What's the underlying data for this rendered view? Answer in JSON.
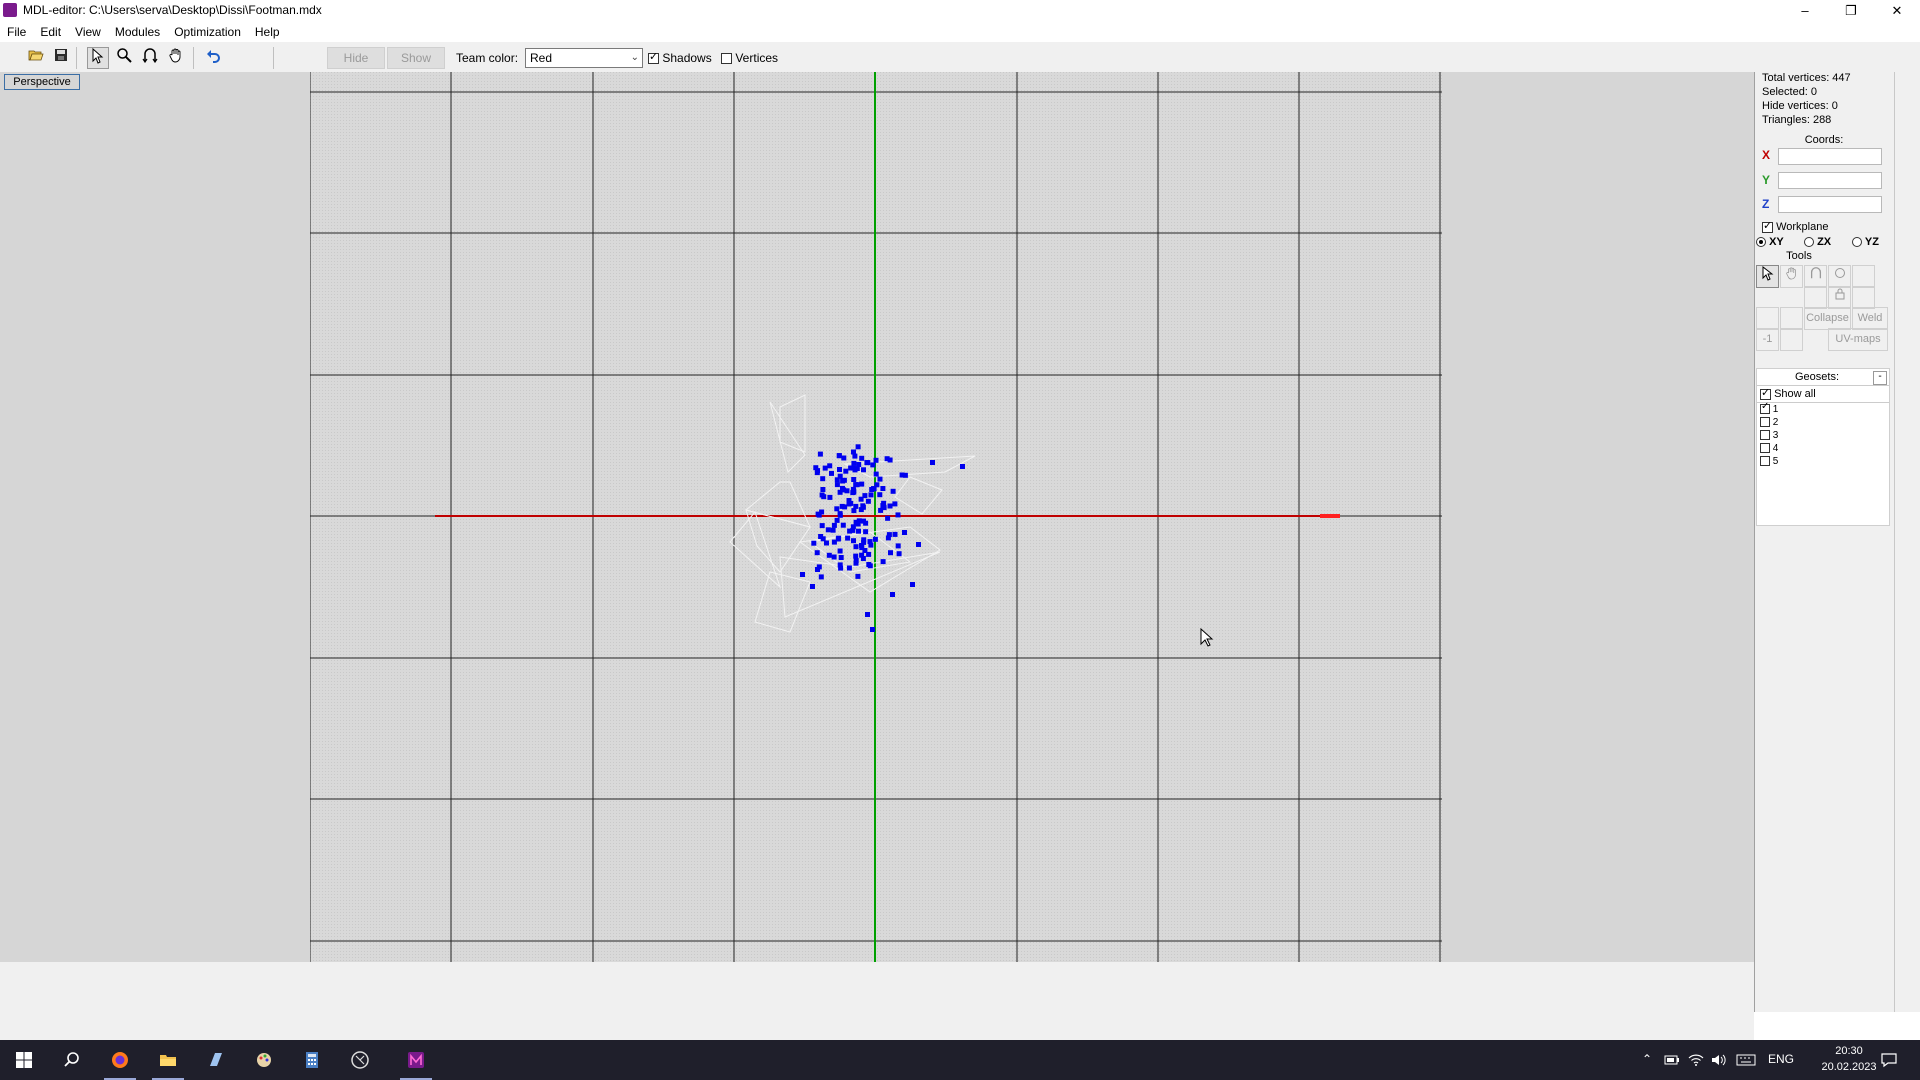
{
  "window": {
    "title": "MDL-editor: C:\\Users\\serva\\Desktop\\Dissi\\Footman.mdx",
    "minimize": "–",
    "maximize": "❐",
    "close": "✕"
  },
  "menu": [
    "File",
    "Edit",
    "View",
    "Modules",
    "Optimization",
    "Help"
  ],
  "toolbar": {
    "hide_label": "Hide",
    "show_label": "Show",
    "team_color_label": "Team color:",
    "team_color_value": "Red",
    "shadows_label": "Shadows",
    "shadows_checked": true,
    "vertices_label": "Vertices",
    "vertices_checked": false
  },
  "viewport": {
    "view_label": "Perspective",
    "axis_colors": {
      "x": "#c00000",
      "y": "#00a000"
    },
    "vertex_color": "#0000ee",
    "wire_color": "#f2f2f2"
  },
  "stats": {
    "total_vertices": "Total vertices: 447",
    "selected": "Selected: 0",
    "hide_vertices": "Hide vertices: 0",
    "triangles": "Triangles: 288"
  },
  "coords": {
    "title": "Coords:",
    "x_label": "X",
    "y_label": "Y",
    "z_label": "Z",
    "x_value": "",
    "y_value": "",
    "z_value": ""
  },
  "workplane": {
    "label": "Workplane",
    "checked": true,
    "planes": [
      {
        "label": "XY",
        "selected": true
      },
      {
        "label": "ZX",
        "selected": false
      },
      {
        "label": "YZ",
        "selected": false
      }
    ]
  },
  "tools": {
    "title": "Tools",
    "collapse_label": "Collapse",
    "weld_label": "Weld",
    "minus_one_label": "-1",
    "uv_maps_label": "UV-maps"
  },
  "geosets": {
    "title": "Geosets:",
    "collapse": "-",
    "show_all_label": "Show all",
    "show_all_checked": true,
    "items": [
      {
        "label": "1",
        "checked": true
      },
      {
        "label": "2",
        "checked": false
      },
      {
        "label": "3",
        "checked": false
      },
      {
        "label": "4",
        "checked": false
      },
      {
        "label": "5",
        "checked": false
      }
    ]
  },
  "taskbar": {
    "apps": [
      "start-icon",
      "search-icon",
      "firefox-icon",
      "file-explorer-icon",
      "app-blue-icon",
      "paint-icon",
      "calculator-icon",
      "app-circle-icon",
      "mdl-editor-icon"
    ],
    "language": "ENG",
    "time": "20:30",
    "date": "20.02.2023"
  }
}
